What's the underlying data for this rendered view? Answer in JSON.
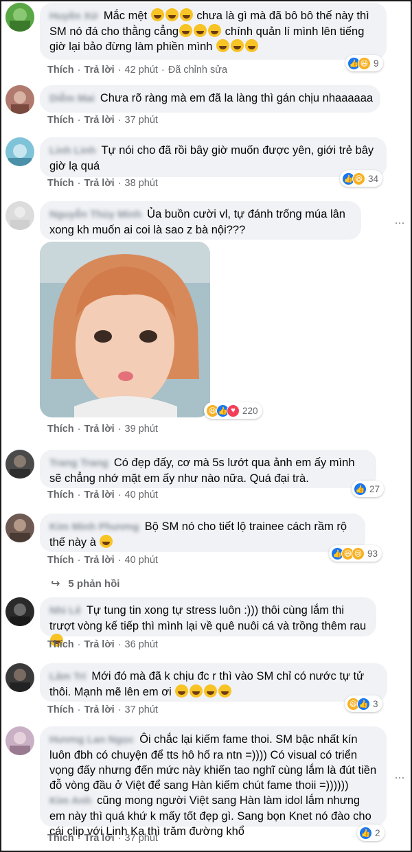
{
  "labels": {
    "like": "Thích",
    "reply": "Trả lời",
    "sep": "·"
  },
  "comments": [
    {
      "name": "Huyền Xứ",
      "text": "Mắc mệt",
      "text2": " chưa là gì mà đã bô bô thế này thì SM nó đá cho thằng cẳng",
      "text3": " chính quản lí mình lên tiếng giờ lại bảo đừng làm phiền mình",
      "time": "42 phút",
      "edited": "Đã chỉnh sửa",
      "reactions": "9"
    },
    {
      "name": "Diễm Mai",
      "text": "Chưa rõ ràng mà em đã la làng thì gán chịu nhaaaaaa",
      "time": "37 phút"
    },
    {
      "name": "Linh Linh",
      "text": "Tự nói cho đã rồi bây giờ muốn được yên, giới trẻ bây giờ lạ quá",
      "time": "38 phút",
      "reactions": "34"
    },
    {
      "name": "Nguyễn Thùy Minh",
      "text": "Ủa buồn cười vl, tự đánh trống múa lân xong kh muốn ai coi là sao z bà nội???",
      "time": "39 phút",
      "reactions": "220"
    },
    {
      "name": "Trang Trang",
      "text": "Có đẹp đấy, cơ mà 5s lướt qua ảnh em ấy mình sẽ chẳng nhớ mặt em ấy như nào nữa. Quá đại trà.",
      "time": "40 phút",
      "reactions": "27"
    },
    {
      "name": "Kim Minh Phương",
      "text": "Bộ SM nó cho tiết lộ trainee cách rầm rộ thế này à",
      "time": "40 phút",
      "reactions": "93",
      "replies": "5 phản hồi"
    },
    {
      "name": "Nhi Lê",
      "text": "Tự tung tin xong tự stress luôn :))) thôi cùng lắm thi trượt vòng kế tiếp thì mình lại về quê nuôi cá và trồng thêm rau",
      "time": "36 phút"
    },
    {
      "name": "Lâm Trí",
      "text": "Mới đó mà đã k chịu đc r thì vào SM chỉ có nước tự tử thôi. Mạnh mẽ lên em ơi",
      "time": "37 phút",
      "reactions": "3"
    },
    {
      "name": "Hương Lan Ngọc",
      "text": "Ôi chắc lại kiếm fame thoi. SM bậc nhất kín luôn đbh có chuyện để tts hô hố ra ntn =)))) Có visual có triển vọng đấy nhưng đến mức này khiến tao nghĩ cùng lắm là đút tiền đỗ vòng đầu ở Việt để sang Hàn kiếm chút fame thoii =)))))) ",
      "text2": "cũng mong người Việt sang Hàn làm idol lắm nhưng em này thì quá khứ k mấy tốt đẹp gì. Sang bọn Knet nó đào cho cái clip với Linh Ka thì trăm đường khổ",
      "tag": "Kim Anh",
      "time": "37 phút",
      "reactions": "2"
    }
  ],
  "colors": {
    "bubble": "#f0f2f5",
    "like": "#1877f2",
    "meta": "#65676b"
  }
}
